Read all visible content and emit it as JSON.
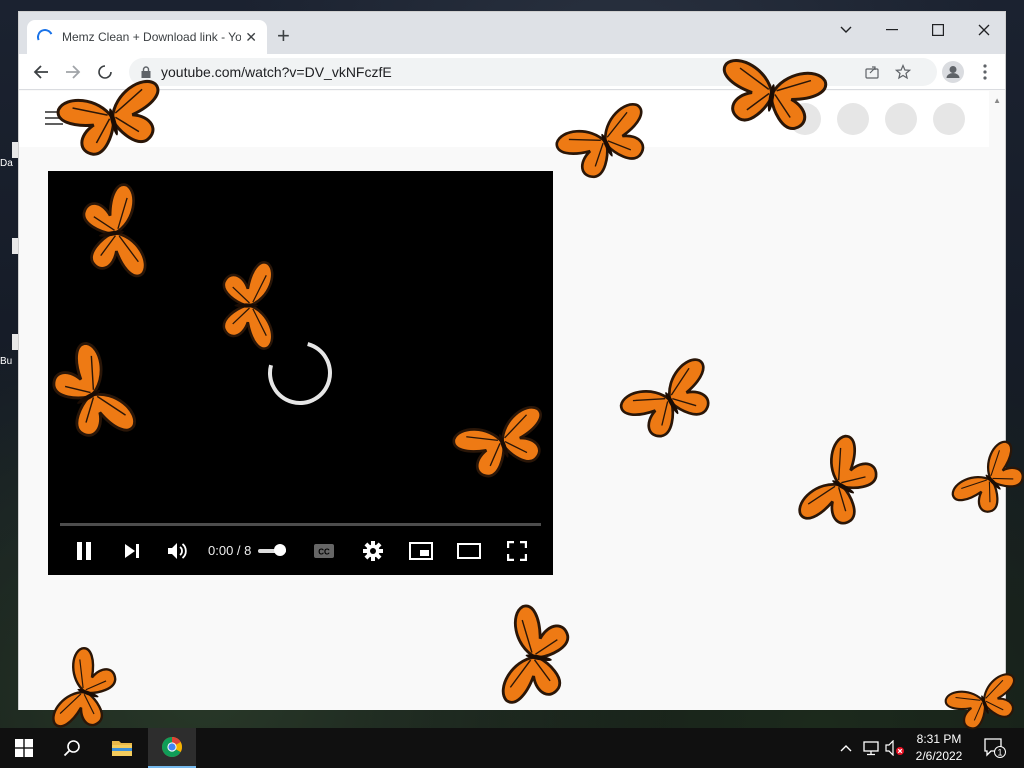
{
  "desktop": {
    "icon_labels": [
      "Da",
      "Bu"
    ]
  },
  "browser": {
    "tab_title": "Memz Clean + Download link - YouTube",
    "tab_close": "✕",
    "new_tab": "+",
    "url": "youtube.com/watch?v=DV_vkNFczfE",
    "window_controls": {
      "dropdown": "⌄",
      "minimize": "—",
      "maximize": "☐",
      "close": "✕"
    }
  },
  "player": {
    "time": "0:00 / 8"
  },
  "taskbar": {
    "time": "8:31 PM",
    "date": "2/6/2022",
    "notification_count": "1"
  },
  "colors": {
    "butterfly_wing": "#ee7a14",
    "butterfly_edge": "#2a1608",
    "chrome_blue": "#1a73e8"
  }
}
